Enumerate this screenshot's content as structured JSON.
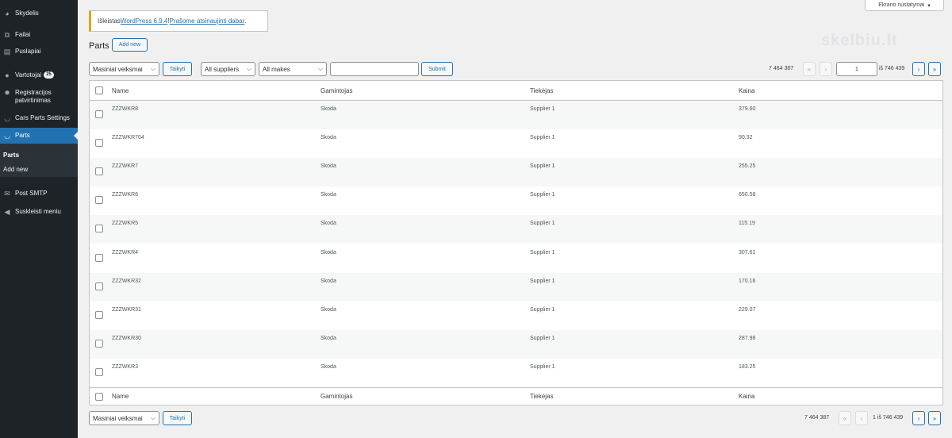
{
  "sidebar": {
    "items": [
      {
        "label": "Skydelis",
        "icon": "dashboard-icon"
      },
      {
        "label": "Failai",
        "icon": "media-icon"
      },
      {
        "label": "Puslapiai",
        "icon": "pages-icon"
      },
      {
        "label": "Vartotojai",
        "icon": "users-icon",
        "badge": "25"
      },
      {
        "label": "Registracijos patvirtinimas",
        "icon": "gear-icon"
      },
      {
        "label": "Cars Parts Settings",
        "icon": "car-icon"
      },
      {
        "label": "Parts",
        "icon": "car-icon"
      },
      {
        "label": "Post SMTP",
        "icon": "mail-icon"
      },
      {
        "label": "Suskleisti meniu",
        "icon": "collapse-icon"
      }
    ],
    "submenu": [
      "Parts",
      "Add new"
    ]
  },
  "screen_options": {
    "label": "Ekrano nustatymai"
  },
  "notice": {
    "prefix": "Išleistas ",
    "link1": "WordPress 6.9.4",
    "mid": "! ",
    "link2": "Prašome atsinaujinti dabar",
    "suffix": "."
  },
  "watermark": "skelbiu.lt",
  "page": {
    "title": "Parts",
    "add_new": "Add new"
  },
  "filters": {
    "bulk_action": "Masiniai veiksmai",
    "apply": "Taikyti",
    "suppliers": "All suppliers",
    "makes": "All makes",
    "search_value": "",
    "submit": "Submit"
  },
  "pagination": {
    "items": "7 464 387",
    "first": "«",
    "prev": "‹",
    "current": "1",
    "of_text": "iš 746 439",
    "next": "›",
    "last": "»"
  },
  "table": {
    "columns": [
      "Name",
      "Gamintojas",
      "Tiekėjas",
      "Kaina"
    ],
    "rows": [
      [
        "ZZZWKR8",
        "Skoda",
        "Supplier 1",
        "379.60"
      ],
      [
        "ZZZWKR704",
        "Skoda",
        "Supplier 1",
        "90.32"
      ],
      [
        "ZZZWKR7",
        "Skoda",
        "Supplier 1",
        "255.25"
      ],
      [
        "ZZZWKR6",
        "Skoda",
        "Supplier 1",
        "650.58"
      ],
      [
        "ZZZWKR5",
        "Skoda",
        "Supplier 1",
        "115.19"
      ],
      [
        "ZZZWKR4",
        "Skoda",
        "Supplier 1",
        "307.61"
      ],
      [
        "ZZZWKR32",
        "Skoda",
        "Supplier 1",
        "170.16"
      ],
      [
        "ZZZWKR31",
        "Skoda",
        "Supplier 1",
        "229.07"
      ],
      [
        "ZZZWKR30",
        "Skoda",
        "Supplier 1",
        "287.98"
      ],
      [
        "ZZZWKR3",
        "Skoda",
        "Supplier 1",
        "183.25"
      ]
    ]
  },
  "bottom": {
    "bulk_action": "Masiniai veiksmai",
    "apply": "Taikyti",
    "items": "7 464 387",
    "first": "«",
    "prev": "‹",
    "current": "1",
    "of_text": "iš 746 439",
    "next": "›",
    "last": "»"
  },
  "colors": {
    "accent": "#2271b1",
    "sidebar": "#1d2327",
    "notice_border": "#dba617"
  }
}
